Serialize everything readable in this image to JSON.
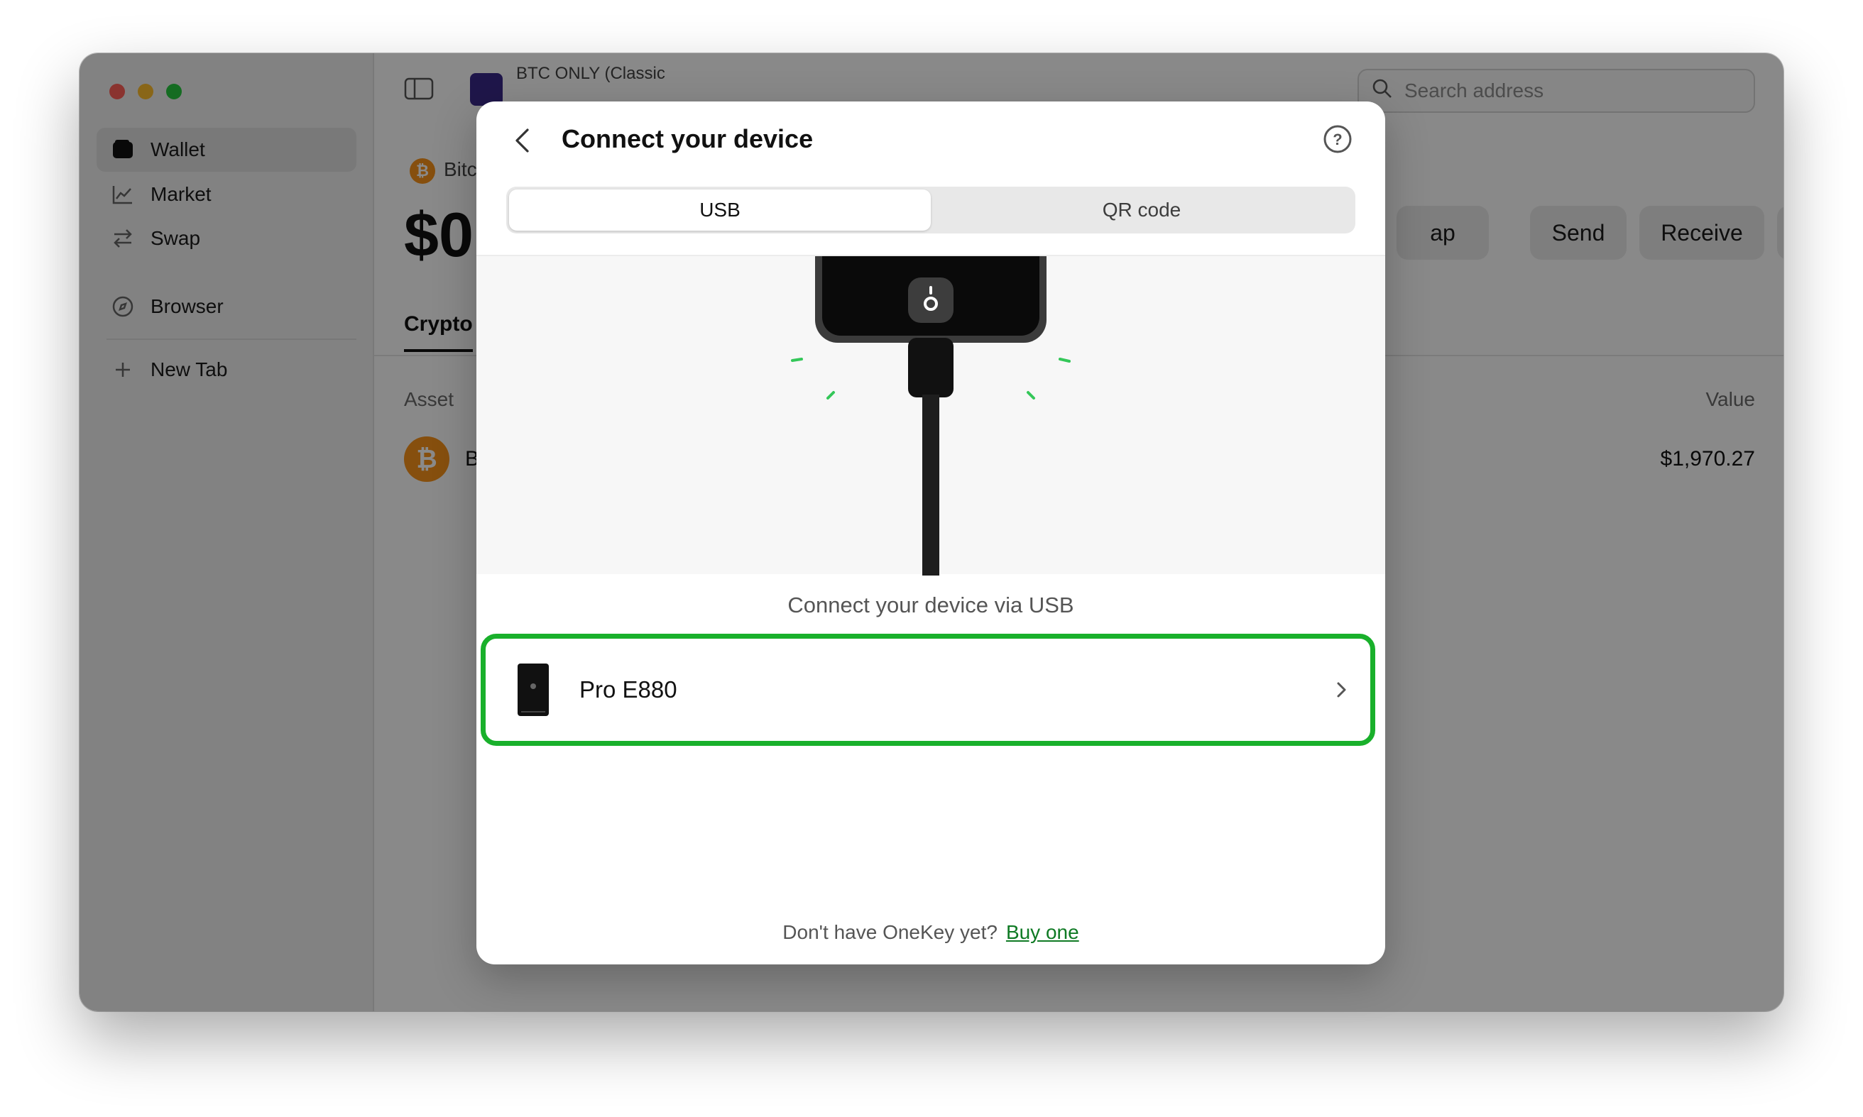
{
  "sidebar": {
    "items": [
      {
        "label": "Wallet"
      },
      {
        "label": "Market"
      },
      {
        "label": "Swap"
      },
      {
        "label": "Browser"
      },
      {
        "label": "New Tab"
      }
    ]
  },
  "header": {
    "tab_title": "BTC ONLY (Classic",
    "search_placeholder": "Search address"
  },
  "wallet": {
    "network": "Bitc",
    "balance": "$0",
    "actions": {
      "swap": "ap",
      "send": "Send",
      "receive": "Receive",
      "more": "···"
    },
    "tab_crypto": "Crypto",
    "col_asset": "Asset",
    "col_value": "Value",
    "row_asset": "B",
    "row_value": "$1,970.27"
  },
  "modal": {
    "title": "Connect your device",
    "segments": [
      "USB",
      "QR code"
    ],
    "selected_segment": "USB",
    "caption": "Connect your device via USB",
    "device_name": "Pro E880",
    "footer_text": "Don't have OneKey yet?",
    "footer_link": "Buy one"
  },
  "colors": {
    "highlight": "#19b02b",
    "accent_link": "#0f7a24",
    "btc": "#f7931a"
  },
  "icons": [
    "wallet-icon",
    "market-icon",
    "swap-icon",
    "browser-icon",
    "plus-icon",
    "sidebar-toggle-icon",
    "search-icon",
    "back-icon",
    "help-icon",
    "device-icon",
    "chevron-right-icon"
  ]
}
